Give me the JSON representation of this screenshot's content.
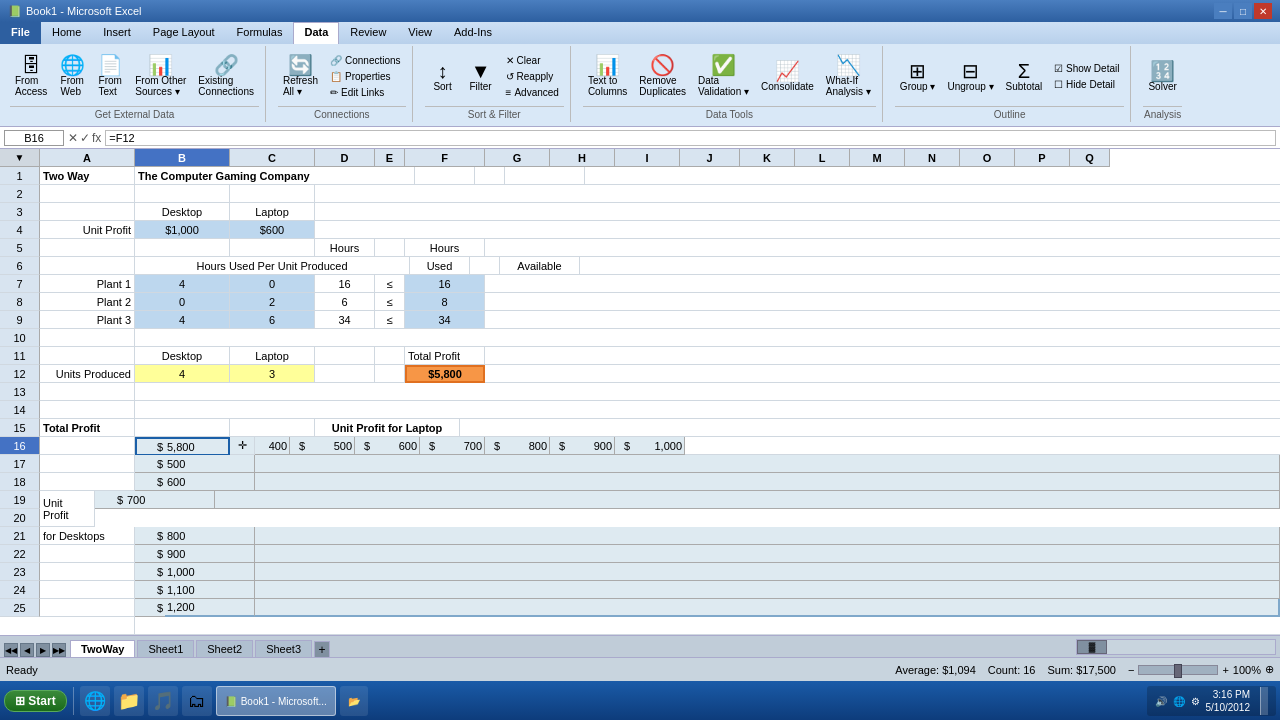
{
  "titleBar": {
    "title": "Book1 - Microsoft Excel",
    "minBtn": "─",
    "maxBtn": "□",
    "closeBtn": "✕"
  },
  "ribbon": {
    "tabs": [
      "File",
      "Home",
      "Insert",
      "Page Layout",
      "Formulas",
      "Data",
      "Review",
      "View",
      "Add-Ins"
    ],
    "activeTab": "Data",
    "groups": {
      "getExternalData": {
        "label": "Get External Data",
        "buttons": [
          "From Access",
          "From Web",
          "From Text",
          "From Other Sources",
          "Existing Connections"
        ]
      },
      "connections": {
        "label": "Connections",
        "buttons": [
          "Refresh All",
          "Connections",
          "Properties",
          "Edit Links"
        ]
      },
      "sortFilter": {
        "label": "Sort & Filter",
        "buttons": [
          "Sort",
          "Filter",
          "Clear",
          "Reapply",
          "Advanced"
        ]
      },
      "dataTools": {
        "label": "Data Tools",
        "buttons": [
          "Text to Columns",
          "Remove Duplicates",
          "Data Validation",
          "Consolidate",
          "What-If Analysis"
        ]
      },
      "outline": {
        "label": "Outline",
        "buttons": [
          "Group",
          "Ungroup",
          "Subtotal",
          "Show Detail",
          "Hide Detail"
        ]
      },
      "analysis": {
        "label": "Analysis",
        "buttons": [
          "Solver"
        ]
      }
    }
  },
  "formulaBar": {
    "cellRef": "B16",
    "formula": "=F12"
  },
  "columns": [
    "A",
    "B",
    "C",
    "D",
    "E",
    "F",
    "G",
    "H",
    "I",
    "J",
    "K",
    "L",
    "M",
    "N",
    "O",
    "P",
    "Q"
  ],
  "rows": {
    "count": 25,
    "rowNums": [
      1,
      2,
      3,
      4,
      5,
      6,
      7,
      8,
      9,
      10,
      11,
      12,
      13,
      14,
      15,
      16,
      17,
      18,
      19,
      20,
      21,
      22,
      23,
      24,
      25
    ]
  },
  "cells": {
    "A1": {
      "value": "Two Way",
      "bold": true
    },
    "B1": {
      "value": "The Computer Gaming Company",
      "bold": true
    },
    "B3": {
      "value": "Desktop",
      "center": true
    },
    "C3": {
      "value": "Laptop",
      "center": true
    },
    "A4": {
      "value": "Unit Profit",
      "right": true
    },
    "B4": {
      "value": "$1,000",
      "blueBg": true,
      "center": true
    },
    "C4": {
      "value": "$600",
      "blueBg": true,
      "center": true
    },
    "D5": {
      "value": "Hours"
    },
    "D6": {
      "value": "Used"
    },
    "F5": {
      "value": "Hours"
    },
    "F6": {
      "value": "Available"
    },
    "A6": {
      "value": "Hours Used Per Unit Produced",
      "colspan": true
    },
    "A7": {
      "value": "Plant 1",
      "right": true
    },
    "B7": {
      "value": "4",
      "blueBg": true,
      "center": true
    },
    "C7": {
      "value": "0",
      "blueBg": true,
      "center": true
    },
    "D7": {
      "value": "16",
      "center": true
    },
    "E7": {
      "value": "≤",
      "center": true
    },
    "F7": {
      "value": "16",
      "blueBg": true,
      "center": true
    },
    "A8": {
      "value": "Plant 2",
      "right": true
    },
    "B8": {
      "value": "0",
      "blueBg": true,
      "center": true
    },
    "C8": {
      "value": "2",
      "blueBg": true,
      "center": true
    },
    "D8": {
      "value": "6",
      "center": true
    },
    "E8": {
      "value": "≤",
      "center": true
    },
    "F8": {
      "value": "8",
      "blueBg": true,
      "center": true
    },
    "A9": {
      "value": "Plant 3",
      "right": true
    },
    "B9": {
      "value": "4",
      "blueBg": true,
      "center": true
    },
    "C9": {
      "value": "6",
      "blueBg": true,
      "center": true
    },
    "D9": {
      "value": "34",
      "center": true
    },
    "E9": {
      "value": "≤",
      "center": true
    },
    "F9": {
      "value": "34",
      "blueBg": true,
      "center": true
    },
    "B11": {
      "value": "Desktop",
      "center": true
    },
    "C11": {
      "value": "Laptop",
      "center": true
    },
    "F11": {
      "value": "Total Profit"
    },
    "A12": {
      "value": "Units Produced",
      "right": true
    },
    "B12": {
      "value": "4",
      "yellowBg": true,
      "center": true
    },
    "C12": {
      "value": "3",
      "yellowBg": true,
      "center": true
    },
    "F12": {
      "value": "$5,800",
      "orangeBg": true,
      "center": true,
      "bold": true
    },
    "A15": {
      "value": "Total Profit",
      "bold": true
    },
    "D15": {
      "value": "Unit Profit for Laptop",
      "bold": true
    },
    "B16": {
      "value": "$",
      "selected": true
    },
    "C16": {
      "value": "5,800",
      "selected": true
    },
    "D16": {
      "value": "400",
      "blueBg2": true,
      "center": true
    },
    "E16_label": {
      "value": "$"
    },
    "E16_val": {
      "value": "500",
      "center": true
    },
    "F16_label": {
      "value": "$"
    },
    "F16_val": {
      "value": "600",
      "center": true
    },
    "G16_label": {
      "value": "$"
    },
    "G16_val": {
      "value": "700",
      "center": true
    },
    "H16_label": {
      "value": "$"
    },
    "H16_val": {
      "value": "800",
      "center": true
    },
    "I16_label": {
      "value": "$"
    },
    "I16_val": {
      "value": "900",
      "center": true
    },
    "J16_label": {
      "value": "$"
    },
    "J16_val": {
      "value": "1,000",
      "center": true
    },
    "B17": {
      "value": "$"
    },
    "C17": {
      "value": "500"
    },
    "B18": {
      "value": "$"
    },
    "C18": {
      "value": "600"
    },
    "A19": {
      "value": "Unit Profit"
    },
    "B19": {
      "value": "$"
    },
    "C19": {
      "value": "700"
    },
    "A20": {
      "value": "for Desktops"
    },
    "B20": {
      "value": "$"
    },
    "C20": {
      "value": "800"
    },
    "B21": {
      "value": "$"
    },
    "C21": {
      "value": "900"
    },
    "B22": {
      "value": "$"
    },
    "C22": {
      "value": "1,000"
    },
    "B23": {
      "value": "$"
    },
    "C23": {
      "value": "1,100"
    },
    "B24": {
      "value": "$"
    },
    "C24": {
      "value": "1,200"
    }
  },
  "sheetTabs": [
    "TwoWay",
    "Sheet1",
    "Sheet2",
    "Sheet3"
  ],
  "activeSheet": "TwoWay",
  "statusBar": {
    "ready": "Ready",
    "average": "Average: $1,094",
    "count": "Count: 16",
    "sum": "Sum: $17,500",
    "zoom": "100%"
  },
  "taskbar": {
    "startLabel": "Start",
    "time": "3:16 PM",
    "date": "5/10/2012",
    "apps": [
      "IE",
      "Explorer",
      "Folder",
      "Media",
      "Excel",
      "Folder2"
    ]
  },
  "icons": {
    "fromAccess": "🗄",
    "fromWeb": "🌐",
    "fromText": "📄",
    "fromOther": "📊",
    "existing": "🔗",
    "refresh": "🔄",
    "connections": "⚙",
    "properties": "📋",
    "editLinks": "🔗",
    "sort": "↕",
    "filter": "▼",
    "clear": "✕",
    "reapply": "↺",
    "advanced": "⚙",
    "textToCol": "📊",
    "removeDup": "🚫",
    "dataValid": "✅",
    "consolidate": "📊",
    "whatIf": "📈",
    "group": "[]",
    "ungroup": "⊞",
    "subtotal": "Σ",
    "showDetail": "+",
    "hideDetail": "-",
    "solver": "S"
  }
}
